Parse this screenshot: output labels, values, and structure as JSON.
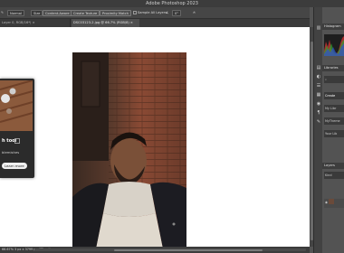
{
  "app": {
    "title": "Adobe Photoshop 2023"
  },
  "options_bar": {
    "mode_value": "Normal",
    "size_value": "Size",
    "content_aware_label": "Content-Aware",
    "create_texture_label": "Create Texture",
    "proximity_match_label": "Proximity Match",
    "sample_all_layers_label": "Sample All Layers",
    "angle_value": "0°"
  },
  "tabs": [
    {
      "label": "Layer 0, RGB/16*) ×",
      "active": false
    },
    {
      "label": "DSC03123-2.jpg @ 66.7% (RGB/8) ×",
      "active": true
    }
  ],
  "status": {
    "zoom_text": "66.67%",
    "doc_text": "3 px x 3799 px (72 ppi)"
  },
  "popup": {
    "title": "h tool",
    "description": "blemishes",
    "button_label": "Learn more"
  },
  "panels": {
    "histogram_label": "Histogram",
    "libraries_label": "Libraries",
    "create_label": "Create",
    "items": [
      "My Libr",
      "MyTheme",
      "Your Lib"
    ],
    "layers_label": "Layers",
    "kind_label": "Kind"
  },
  "colors": {
    "app_bg": "#535353",
    "canvas": "#ffffff",
    "accent": "#1473e6"
  }
}
